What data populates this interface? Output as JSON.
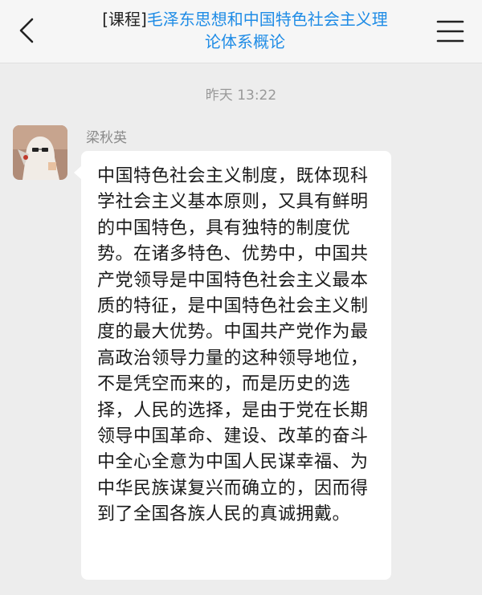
{
  "header": {
    "tag": "[课程]",
    "title": "毛泽东思想和中国特色社会主义理论体系概论"
  },
  "chat": {
    "timestamp": "昨天 13:22",
    "message": {
      "sender": "梁秋英",
      "text": "中国特色社会主义制度，既体现科学社会主义基本原则，又具有鲜明的中国特色，具有独特的制度优势。在诸多特色、优势中，中国共产党领导是中国特色社会主义最本质的特征，是中国特色社会主义制度的最大优势。中国共产党作为最高政治领导力量的这种领导地位，不是凭空而来的，而是历史的选择，人民的选择，是由于党在长期领导中国革命、建设、改革的奋斗中全心全意为中国人民谋幸福、为中华民族谋复兴而确立的，因而得到了全国各族人民的真诚拥戴。"
    }
  },
  "colors": {
    "accent": "#1f8ce6",
    "background": "#ededed",
    "bubble": "#ffffff"
  },
  "icons": {
    "back": "chevron-left-icon",
    "menu": "hamburger-menu-icon"
  }
}
